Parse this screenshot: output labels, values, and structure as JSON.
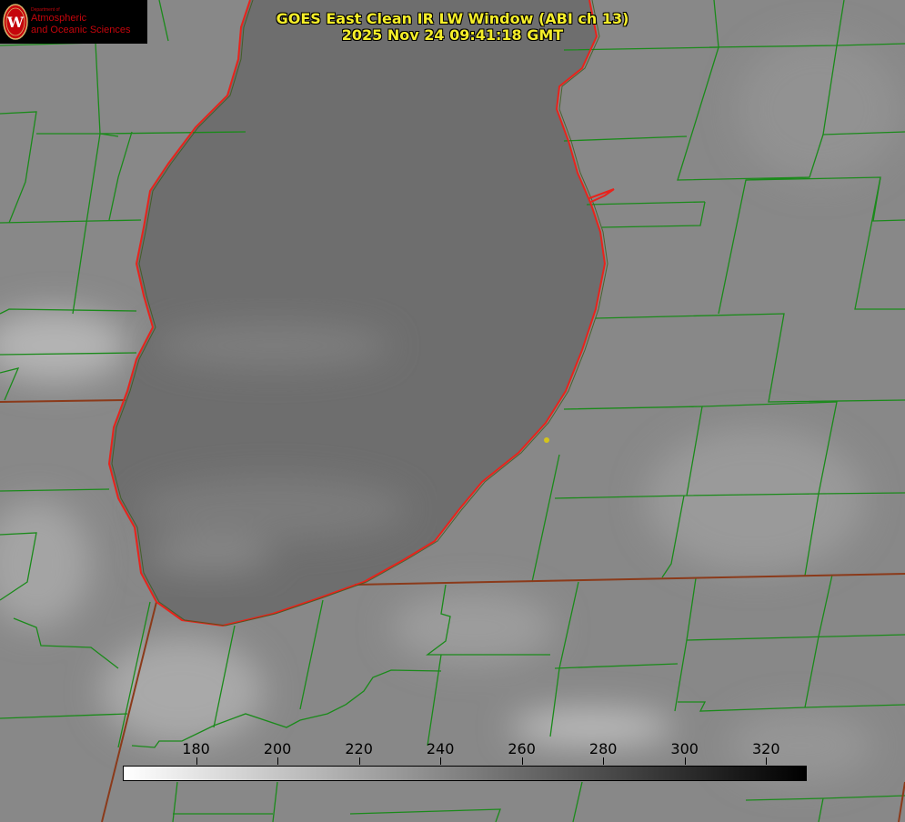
{
  "title": {
    "line1": "GOES East Clean IR LW Window (ABI ch 13)",
    "line2": "2025 Nov 24 09:41:18 GMT"
  },
  "logo": {
    "dept": "Department of",
    "line1": "Atmospheric",
    "line2": "and Oceanic Sciences",
    "seal_letter": "W"
  },
  "colorbar": {
    "min": 162,
    "max": 330,
    "ticks": [
      180,
      200,
      220,
      240,
      260,
      280,
      300,
      320
    ],
    "unit": "",
    "gradient": [
      "#ffffff",
      "#000000"
    ]
  },
  "colors": {
    "county_lines": "#1a8a1a",
    "coastline": "#e8231c",
    "title_text": "#f5ee2a",
    "marker": "#d4c41a",
    "logo_red": "#c5050c"
  }
}
